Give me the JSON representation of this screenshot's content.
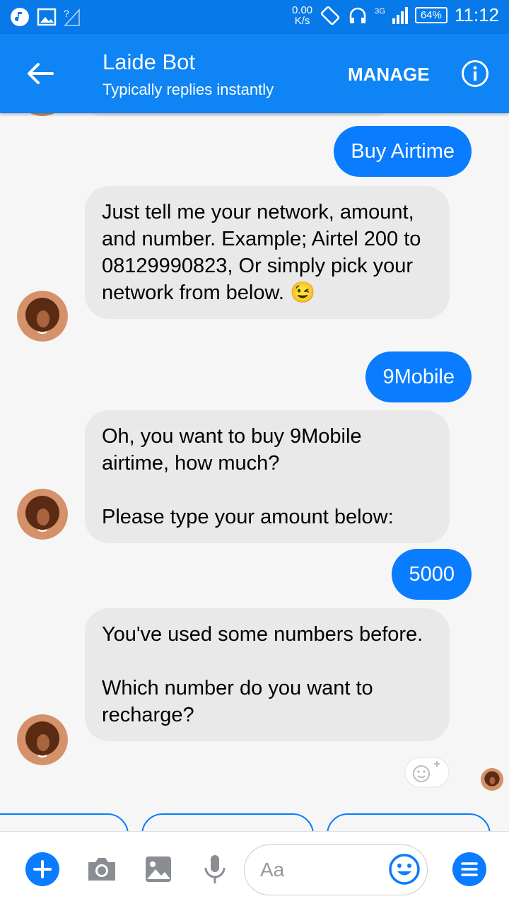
{
  "status_bar": {
    "speed_value": "0.00",
    "speed_unit": "K/s",
    "network": "3G",
    "battery": "64%",
    "time": "11:12"
  },
  "header": {
    "title": "Laide Bot",
    "subtitle": "Typically replies instantly",
    "manage_label": "MANAGE"
  },
  "messages": [
    {
      "from": "user",
      "text": "Buy Airtime"
    },
    {
      "from": "bot",
      "text": "Just tell me your network, amount, and number. Example; Airtel 200 to 08129990823, Or simply pick your network from below. 😉"
    },
    {
      "from": "user",
      "text": "9Mobile"
    },
    {
      "from": "bot",
      "text": "Oh, you want to buy 9Mobile airtime, how much?\n\nPlease type your amount below:"
    },
    {
      "from": "user",
      "text": "5000"
    },
    {
      "from": "bot",
      "text": "You've used some numbers before.\n\nWhich number do you want to recharge?"
    }
  ],
  "composer": {
    "placeholder": "Aa"
  },
  "colors": {
    "brand_blue": "#0e84f5",
    "bubble_blue": "#0a7cff",
    "bot_bubble": "#e9e9e9"
  },
  "icons": [
    "back-arrow-icon",
    "info-icon",
    "plus-icon",
    "camera-icon",
    "image-icon",
    "microphone-icon",
    "emoji-icon",
    "menu-icon",
    "add-reaction-icon"
  ]
}
